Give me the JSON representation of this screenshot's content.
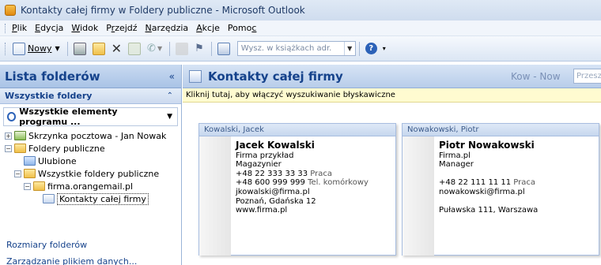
{
  "window": {
    "title": "Kontakty całej firmy w Foldery publiczne - Microsoft Outlook"
  },
  "menu": [
    {
      "pre": "",
      "ul": "P",
      "post": "lik"
    },
    {
      "pre": "",
      "ul": "E",
      "post": "dycja"
    },
    {
      "pre": "",
      "ul": "W",
      "post": "idok"
    },
    {
      "pre": "P",
      "ul": "r",
      "post": "zejdź"
    },
    {
      "pre": "",
      "ul": "N",
      "post": "arzędzia"
    },
    {
      "pre": "",
      "ul": "A",
      "post": "kcje"
    },
    {
      "pre": "Pomo",
      "ul": "c",
      "post": ""
    }
  ],
  "toolbar": {
    "new_label": "Nowy",
    "search_placeholder": "Wysz. w książkach adr."
  },
  "left_pane": {
    "title": "Lista folderów",
    "section": "Wszystkie foldery",
    "combo": "Wszystkie elementy programu ...",
    "tree": [
      {
        "label": "Skrzynka pocztowa - Jan Nowak",
        "indent": 0,
        "exp": "+",
        "icon": "mbox"
      },
      {
        "label": "Foldery publiczne",
        "indent": 0,
        "exp": "-",
        "icon": "folder-yellow"
      },
      {
        "label": "Ulubione",
        "indent": 1,
        "exp": "",
        "icon": "folder-blue"
      },
      {
        "label": "Wszystkie foldery publiczne",
        "indent": 1,
        "exp": "-",
        "icon": "folder-yellow"
      },
      {
        "label": "firma.orangemail.pl",
        "indent": 2,
        "exp": "-",
        "icon": "folder-yellow"
      },
      {
        "label": "Kontakty całej firmy",
        "indent": 3,
        "exp": "",
        "icon": "contact-ico",
        "selected": true
      }
    ],
    "links": [
      "Rozmiary folderów",
      "Zarządzanie plikiem danych..."
    ]
  },
  "right_pane": {
    "title": "Kontakty całej firmy",
    "range": "Kow - Now",
    "search": "Przeszu",
    "infobar": "Kliknij tutaj, aby włączyć wyszukiwanie błyskawiczne"
  },
  "cards": [
    {
      "header": "Kowalski, Jacek",
      "name": "Jacek Kowalski",
      "lines": [
        {
          "text": "Firma przykład",
          "label": ""
        },
        {
          "text": "Magazynier",
          "label": ""
        },
        {
          "text": "+48 22 333 33 33",
          "label": "Praca"
        },
        {
          "text": "+48 600 999 999",
          "label": "Tel. komórkowy"
        },
        {
          "text": "jkowalski@firma.pl",
          "label": ""
        },
        {
          "text": "Poznań, Gdańska 12",
          "label": ""
        },
        {
          "text": "www.firma.pl",
          "label": ""
        }
      ]
    },
    {
      "header": "Nowakowski, Piotr",
      "name": "Piotr Nowakowski",
      "lines": [
        {
          "text": "Firma.pl",
          "label": ""
        },
        {
          "text": "Manager",
          "label": ""
        },
        {
          "text": "",
          "label": ""
        },
        {
          "text": "+48 22 111 11 11",
          "label": "Praca"
        },
        {
          "text": "nowakowski@firma.pl",
          "label": ""
        },
        {
          "text": "",
          "label": ""
        },
        {
          "text": "Puławska 111, Warszawa",
          "label": ""
        }
      ]
    }
  ]
}
